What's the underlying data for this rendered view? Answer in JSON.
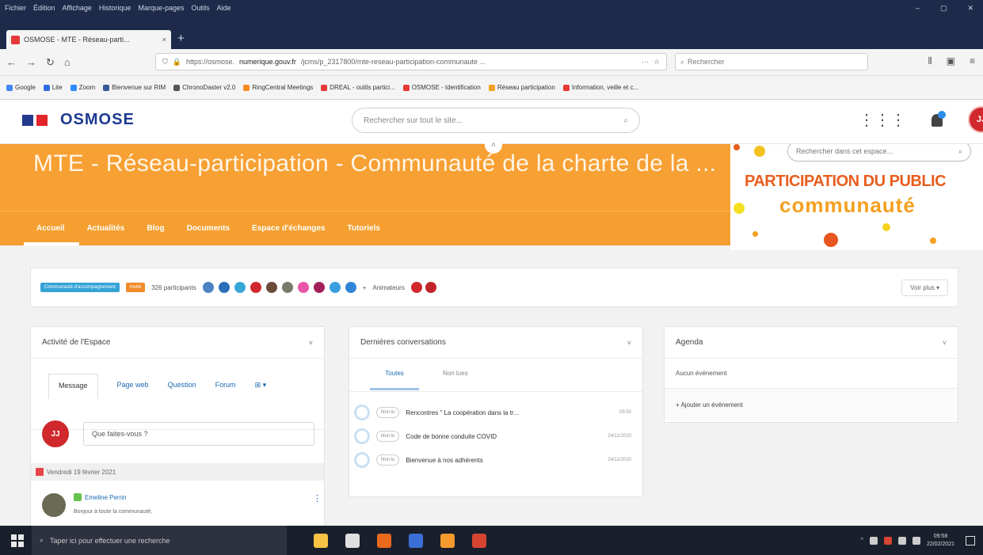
{
  "browser": {
    "menu": [
      "Fichier",
      "Édition",
      "Affichage",
      "Historique",
      "Marque-pages",
      "Outils",
      "Aide"
    ],
    "window_controls": [
      "–",
      "▢",
      "✕"
    ],
    "tab_title": "OSMOSE - MTE - Réseau-parti...",
    "tab_close": "×",
    "new_tab": "+",
    "url_prefix": "https://osmose.",
    "url_domain": "numerique.gouv.fr",
    "url_path": "/jcms/p_2317800/mte-reseau-participation-communaute ...",
    "url_more": "···",
    "search_placeholder": "Rechercher",
    "bookmarks": [
      {
        "label": "Google",
        "color": "#4285f4"
      },
      {
        "label": "Lite",
        "color": "#2d6cdf"
      },
      {
        "label": "Zoom",
        "color": "#2d8cff"
      },
      {
        "label": "Bienvenue sur RIM",
        "color": "#3b5998"
      },
      {
        "label": "ChronoDaster v2.0",
        "color": "#555555"
      },
      {
        "label": "RingCentral Meetings",
        "color": "#f68b1f"
      },
      {
        "label": "DREAL - outils partici...",
        "color": "#e53935"
      },
      {
        "label": "OSMOSE - Identification",
        "color": "#e53935"
      },
      {
        "label": "Réseau participation",
        "color": "#f4a021"
      },
      {
        "label": "Information, veille et c...",
        "color": "#e53935"
      }
    ]
  },
  "site": {
    "logo_text": "OSMOSE",
    "search_placeholder": "Rechercher sur tout le site...",
    "grid_icon": "⋮⋮⋮",
    "avatar_initials": "JJ"
  },
  "space": {
    "title": "MTE - Réseau-participation - Communauté de la charte de la ...",
    "nav": [
      "Accueil",
      "Actualités",
      "Blog",
      "Documents",
      "Espace d'échanges",
      "Tutoriels"
    ],
    "space_search_placeholder": "Rechercher dans cet espace...",
    "image_line1": "PARTICIPATION DU PUBLIC",
    "image_line2": "communauté"
  },
  "participants": {
    "badge_community": "Communauté d'accompagnement",
    "badge_member": "Invité",
    "count_label": "326 participants",
    "more_label": "+",
    "managers_label": "Animateurs",
    "see_more": "Voir plus ▾",
    "avatar_colors": [
      "#4b83c4",
      "#2b6fb8",
      "#38a7d8",
      "#d0282c",
      "#6b4a3a",
      "#7a7a6a",
      "#e955a8",
      "#a3215a",
      "#3a9fe0",
      "#2f86d8"
    ],
    "manager_colors": [
      "#d0282c",
      "#c1242a"
    ]
  },
  "activity": {
    "title": "Activité de l'Espace",
    "chevron": "˅",
    "tabs": [
      "Message",
      "Page web",
      "Question",
      "Forum",
      "⊞ ▾"
    ],
    "composer_initials": "JJ",
    "composer_placeholder": "Que faites-vous ?",
    "day": "Vendredi 19 février 2021",
    "author": "Emeline Perrin",
    "activity_text": "Bonjour à toute la communauté,",
    "dots": "⋮"
  },
  "conversations": {
    "title": "Dernières conversations",
    "chevron": "˅",
    "tabs": [
      "Toutes",
      "Non lues"
    ],
    "items": [
      {
        "status": "Non lu",
        "title": "Rencontres \" La coopération dans la tr...",
        "date": "09:50"
      },
      {
        "status": "Non lu",
        "title": "Code de bonne conduite COVID",
        "date": "24/11/2020"
      },
      {
        "status": "Non lu",
        "title": "Bienvenue à nos adhérents",
        "date": "24/11/2020"
      }
    ]
  },
  "agenda": {
    "title": "Agenda",
    "chevron": "˅",
    "empty": "Aucun événement",
    "add": "+ Ajouter un événement"
  },
  "taskbar": {
    "search_placeholder": "Taper ici pour effectuer une recherche",
    "time": "09:58",
    "date": "22/02/2021",
    "app_colors": [
      "#f6c344",
      "#e0e0e0",
      "#e96a1c",
      "#3b6fd8",
      "#f59b2d",
      "#d64531"
    ]
  }
}
